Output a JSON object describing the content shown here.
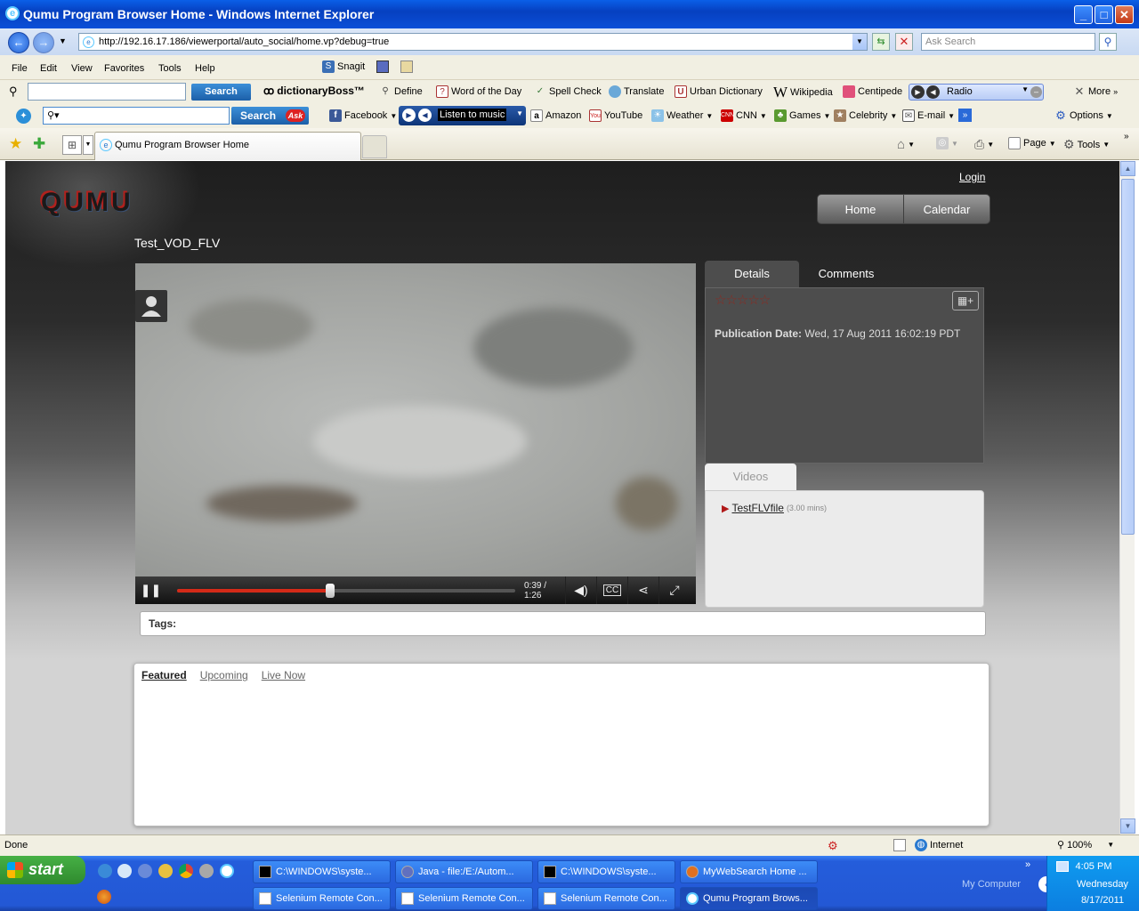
{
  "window": {
    "title": "Qumu Program Browser Home - Windows Internet Explorer"
  },
  "address": {
    "url": "http://192.16.17.186/viewerportal/auto_social/home.vp?debug=true",
    "search_placeholder": "Ask Search"
  },
  "menu": [
    "File",
    "Edit",
    "View",
    "Favorites",
    "Tools",
    "Help"
  ],
  "snagit": "Snagit",
  "toolbar1": {
    "search_btn": "Search",
    "dictionary": "dictionaryBoss™",
    "items": [
      "Define",
      "Word of the Day",
      "Spell Check",
      "Translate",
      "Urban Dictionary",
      "Wikipedia",
      "Centipede"
    ],
    "radio": "Radio",
    "more": "More"
  },
  "toolbar2": {
    "search_btn": "Search",
    "listen": "Listen to music",
    "items": [
      "Facebook",
      "Amazon",
      "YouTube",
      "Weather",
      "CNN",
      "Games",
      "Celebrity",
      "E-mail"
    ],
    "options": "Options"
  },
  "tabs": {
    "active": "Qumu Program Browser Home",
    "page": "Page",
    "tools": "Tools"
  },
  "site": {
    "logo": "QUMU",
    "login": "Login",
    "nav": [
      "Home",
      "Calendar"
    ],
    "video_title": "Test_VOD_FLV",
    "player": {
      "time": "0:39 / 1:26",
      "progress": 0.453
    },
    "details_tabs": [
      "Details",
      "Comments"
    ],
    "rating_stars": "☆☆☆☆☆",
    "publication_label": "Publication Date:",
    "publication_value": "Wed, 17 Aug 2011 16:02:19 PDT",
    "videos_tab": "Videos",
    "video_item": "TestFLVfile",
    "video_duration": "(3.00 mins)",
    "tags_label": "Tags:",
    "featured_tabs": [
      "Featured",
      "Upcoming",
      "Live Now"
    ]
  },
  "status": {
    "text": "Done",
    "zone": "Internet",
    "zoom": "100%"
  },
  "taskbar": {
    "start": "start",
    "row1": [
      "C:\\WINDOWS\\syste...",
      "Java - file:/E:/Autom...",
      "C:\\WINDOWS\\syste...",
      "MyWebSearch Home ..."
    ],
    "row2": [
      "Selenium Remote Con...",
      "Selenium Remote Con...",
      "Selenium Remote Con...",
      "Qumu Program Brows..."
    ],
    "my_computer": "My Computer",
    "clock": {
      "time": "4:05 PM",
      "day": "Wednesday",
      "date": "8/17/2011"
    }
  }
}
